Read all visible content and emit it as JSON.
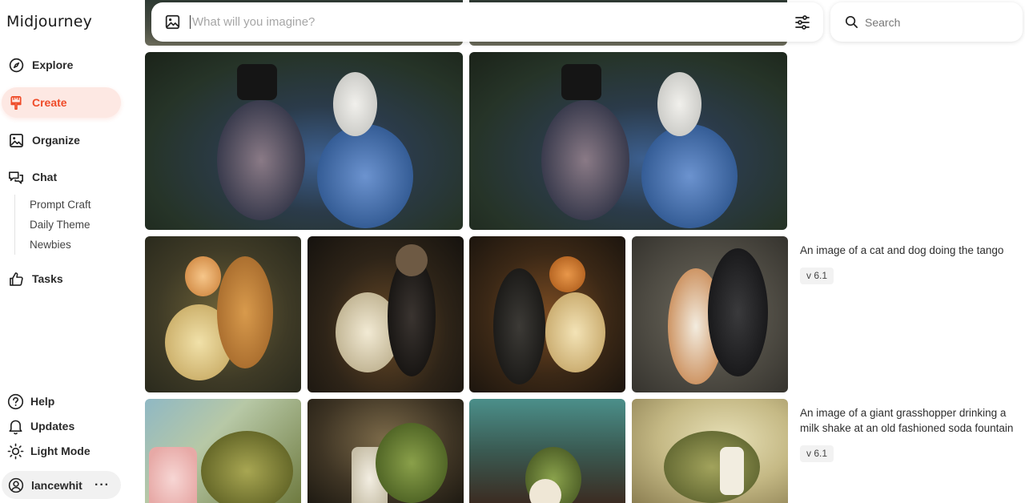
{
  "app": {
    "logo": "Midjourney"
  },
  "sidebar": {
    "nav": [
      {
        "label": "Explore",
        "icon": "compass-icon"
      },
      {
        "label": "Create",
        "icon": "brush-icon",
        "active": true
      },
      {
        "label": "Organize",
        "icon": "image-icon"
      },
      {
        "label": "Chat",
        "icon": "chat-icon"
      }
    ],
    "chat_channels": [
      "Prompt Craft",
      "Daily Theme",
      "Newbies"
    ],
    "tasks": {
      "label": "Tasks",
      "icon": "thumbs-up-icon"
    },
    "bottom": [
      {
        "label": "Help",
        "icon": "help-icon"
      },
      {
        "label": "Updates",
        "icon": "bell-icon"
      },
      {
        "label": "Light Mode",
        "icon": "sun-icon"
      }
    ],
    "user": {
      "name": "lancewhit",
      "more": "···"
    }
  },
  "topbar": {
    "imagine_placeholder": "What will you imagine?",
    "search_placeholder": "Search"
  },
  "feed": [
    {
      "prompt": "An image of a cat and dog doing the tango",
      "version": "v 6.1"
    },
    {
      "prompt": "An image of a giant grasshopper drinking a milk shake at an old fashioned soda fountain",
      "version": "v 6.1"
    }
  ],
  "colors": {
    "accent": "#ef4b29",
    "active_bg": "#fde8e3"
  }
}
